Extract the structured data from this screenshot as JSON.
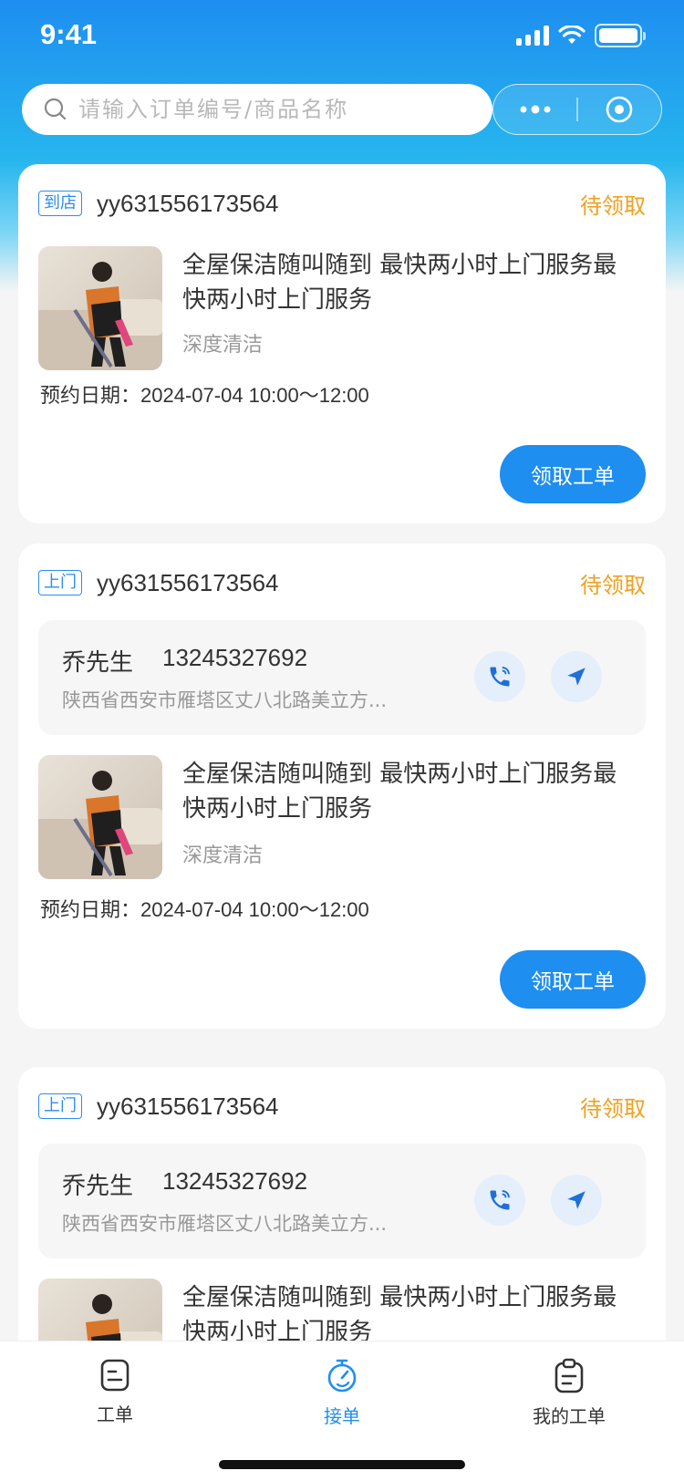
{
  "status_bar": {
    "time": "9:41"
  },
  "search": {
    "placeholder": "请输入订单编号/商品名称"
  },
  "orders": [
    {
      "tag": "到店",
      "order_no": "yy631556173564",
      "status": "待领取",
      "product_title": "全屋保洁随叫随到 最快两小时上门服务最快两小时上门服务",
      "product_sub": "深度清洁",
      "appt_label": "预约日期：",
      "appt_value": "2024-07-04 10:00～12:00",
      "action": "领取工单"
    },
    {
      "tag": "上门",
      "order_no": "yy631556173564",
      "status": "待领取",
      "contact_name": "乔先生",
      "contact_phone": "13245327692",
      "contact_address": "陕西省西安市雁塔区丈八北路美立方...",
      "product_title": "全屋保洁随叫随到 最快两小时上门服务最快两小时上门服务",
      "product_sub": "深度清洁",
      "appt_label": "预约日期：",
      "appt_value": "2024-07-04 10:00～12:00",
      "action": "领取工单"
    },
    {
      "tag": "上门",
      "order_no": "yy631556173564",
      "status": "待领取",
      "contact_name": "乔先生",
      "contact_phone": "13245327692",
      "contact_address": "陕西省西安市雁塔区丈八北路美立方...",
      "product_title": "全屋保洁随叫随到 最快两小时上门服务最快两小时上门服务"
    }
  ],
  "tabbar": {
    "items": [
      {
        "label": "工单",
        "icon": "work-order-icon"
      },
      {
        "label": "接单",
        "icon": "stopwatch-icon",
        "active": true
      },
      {
        "label": "我的工单",
        "icon": "clipboard-icon"
      }
    ]
  },
  "colors": {
    "primary": "#1e8ef0",
    "status_pending": "#f0a020",
    "tag_border": "#2d8cf0"
  }
}
